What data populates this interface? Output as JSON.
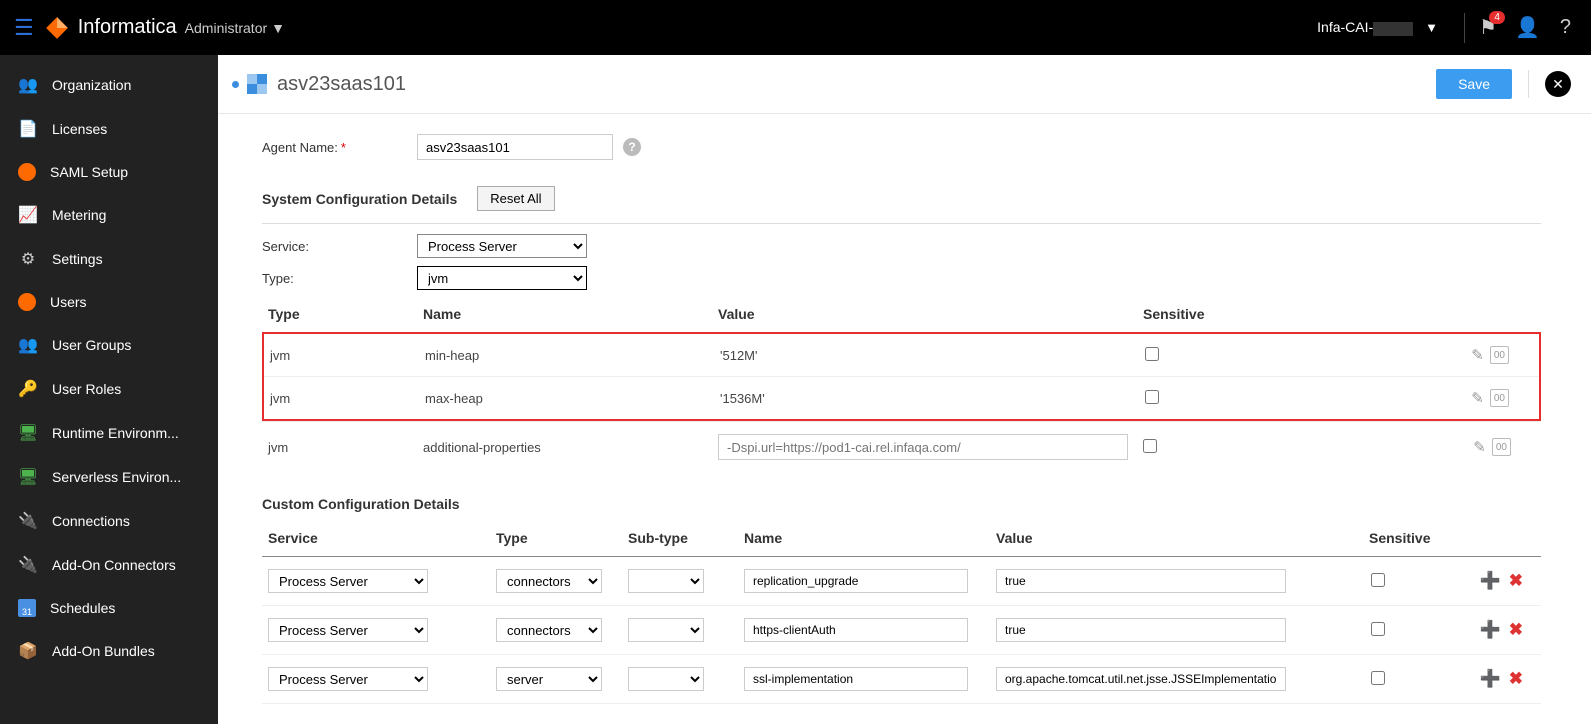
{
  "topbar": {
    "brand": "Informatica",
    "subbrand": "Administrator",
    "org": "Infa-CAI-",
    "badge_count": "4"
  },
  "sidebar": {
    "items": [
      {
        "label": "Organization"
      },
      {
        "label": "Licenses"
      },
      {
        "label": "SAML Setup"
      },
      {
        "label": "Metering"
      },
      {
        "label": "Settings"
      },
      {
        "label": "Users"
      },
      {
        "label": "User Groups"
      },
      {
        "label": "User Roles"
      },
      {
        "label": "Runtime Environm..."
      },
      {
        "label": "Serverless Environ..."
      },
      {
        "label": "Connections"
      },
      {
        "label": "Add-On Connectors"
      },
      {
        "label": "Schedules"
      },
      {
        "label": "Add-On Bundles"
      }
    ]
  },
  "page": {
    "title": "asv23saas101",
    "save_label": "Save",
    "agent_name_label": "Agent Name:",
    "agent_name_value": "asv23saas101",
    "sys_config_title": "System Configuration Details",
    "reset_label": "Reset All",
    "service_label": "Service:",
    "service_value": "Process Server",
    "type_label": "Type:",
    "type_value": "jvm",
    "sys_headers": {
      "type": "Type",
      "name": "Name",
      "value": "Value",
      "sensitive": "Sensitive"
    },
    "sys_rows": [
      {
        "type": "jvm",
        "name": "min-heap",
        "value": "'512M'"
      },
      {
        "type": "jvm",
        "name": "max-heap",
        "value": "'1536M'"
      },
      {
        "type": "jvm",
        "name": "additional-properties",
        "value_ph": "-Dspi.url=https://pod1-cai.rel.infaqa.com/"
      }
    ],
    "custom_title": "Custom Configuration Details",
    "custom_headers": {
      "service": "Service",
      "type": "Type",
      "subtype": "Sub-type",
      "name": "Name",
      "value": "Value",
      "sensitive": "Sensitive"
    },
    "custom_rows": [
      {
        "service": "Process Server",
        "type": "connectors",
        "subtype": "",
        "name": "replication_upgrade",
        "value": "true"
      },
      {
        "service": "Process Server",
        "type": "connectors",
        "subtype": "",
        "name": "https-clientAuth",
        "value": "true"
      },
      {
        "service": "Process Server",
        "type": "server",
        "subtype": "",
        "name": "ssl-implementation",
        "value": "org.apache.tomcat.util.net.jsse.JSSEImplementation"
      }
    ]
  }
}
